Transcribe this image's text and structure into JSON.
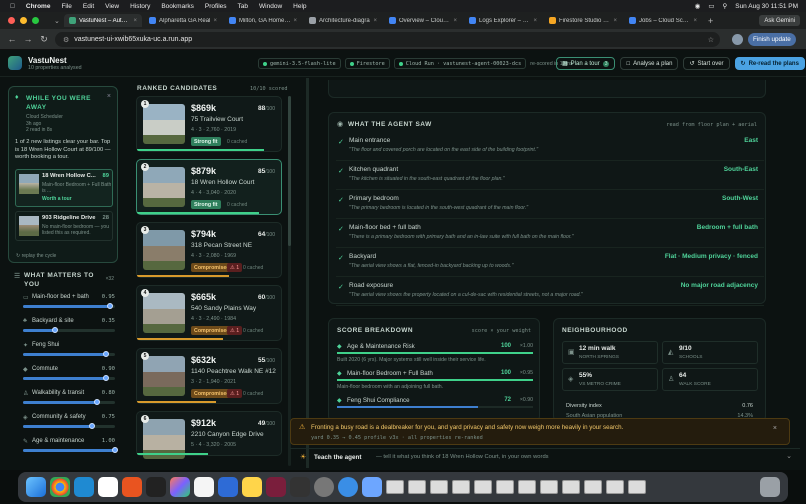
{
  "mac_menu": {
    "app": "Chrome",
    "items": [
      "File",
      "Edit",
      "View",
      "History",
      "Bookmarks",
      "Profiles",
      "Tab",
      "Window",
      "Help"
    ],
    "clock": "Sun Aug 30  11:51 PM",
    "assistant": "Ask Gemini"
  },
  "tabs": [
    {
      "label": "VastuNest – Autono",
      "active": true,
      "color": "#3fa37a"
    },
    {
      "label": "Alpharetta GA Real",
      "active": false,
      "color": "#4285f4"
    },
    {
      "label": "Milton, GA Homes f",
      "active": false,
      "color": "#4285f4"
    },
    {
      "label": "Architecture-diagra",
      "active": false,
      "color": "#9aa0a6"
    },
    {
      "label": "Overview – Cloud R",
      "active": false,
      "color": "#4285f4"
    },
    {
      "label": "Logs Explorer – Log",
      "active": false,
      "color": "#4285f4"
    },
    {
      "label": "Firestore Studio – F",
      "active": false,
      "color": "#f5a623"
    },
    {
      "label": "Jobs – Cloud Schedu",
      "active": false,
      "color": "#4285f4"
    }
  ],
  "address": {
    "url": "vastunest-ui-xwib65xuka-uc.a.run.app",
    "update": "Finish update"
  },
  "app": {
    "name": "VastuNest",
    "subtitle": "10 properties analysed",
    "chips": [
      "gemini-3.5-flash-lite",
      "Firestore",
      "Cloud Run · vastunest-agent-00023-dcs"
    ],
    "rescored": "re-scored in 13ms",
    "plan_tour": "Plan a tour",
    "plan_tour_count": "3",
    "analyse": "Analyse a plan",
    "start_over": "Start over",
    "reread": "Re-read the plans"
  },
  "away": {
    "title": "WHILE YOU WERE AWAY",
    "meta1": "Cloud Scheduler",
    "meta2": "3h ago",
    "meta3": "2 read in 8s",
    "body": "1 of 2 new listings clear your bar. Top is 18 Wren Hollow Court at 89/100 — worth booking a tour.",
    "items": [
      {
        "name": "18 Wren Hollow C...",
        "score": "89",
        "desc": "Main-floor Bedroom + Full Bath is ...",
        "action": "Worth a tour"
      },
      {
        "name": "903 Ridgeline Drive",
        "score": "28",
        "desc": "No main-floor bedroom — you listed this as required.",
        "action": ""
      }
    ],
    "replay": "replay the cycle"
  },
  "matters": {
    "title": "WHAT MATTERS TO YOU",
    "count": "×32",
    "sliders": [
      {
        "label": "Main-floor bed + bath",
        "value": 0.95,
        "display": "0.95",
        "icon": "bed-icon"
      },
      {
        "label": "Backyard & site",
        "value": 0.35,
        "display": "0.35",
        "icon": "tree-icon"
      },
      {
        "label": "Feng Shui",
        "value": 0.9,
        "display": "",
        "icon": "compass-icon"
      },
      {
        "label": "Commute",
        "value": 0.9,
        "display": "0.90",
        "icon": "car-icon"
      },
      {
        "label": "Walkability & transit",
        "value": 0.8,
        "display": "0.80",
        "icon": "walk-icon"
      },
      {
        "label": "Community & safety",
        "value": 0.75,
        "display": "0.75",
        "icon": "shield-icon"
      },
      {
        "label": "Age & maintenance",
        "value": 1.0,
        "display": "1.00",
        "icon": "wrench-icon"
      }
    ]
  },
  "ranked": {
    "title": "RANKED CANDIDATES",
    "count": "10/10 scored",
    "cards": [
      {
        "rank": "1",
        "price": "$869k",
        "score": "88",
        "address": "75 Trailview Court",
        "specs": "4 · 3 · 2,760 · 2019",
        "badge": "Strong fit",
        "badge_type": "fit",
        "warn": "",
        "cached": "0 cached",
        "fill": 0.88,
        "sky": "#9ab3c4",
        "house": "#c9cdc6"
      },
      {
        "rank": "2",
        "price": "$879k",
        "score": "85",
        "address": "18 Wren Hollow Court",
        "specs": "4 · 4 · 3,040 · 2020",
        "badge": "Strong fit",
        "badge_type": "fit",
        "warn": "",
        "cached": "0 cached",
        "fill": 0.85,
        "sky": "#8fa8b8",
        "house": "#b9b3a5"
      },
      {
        "rank": "3",
        "price": "$794k",
        "score": "64",
        "address": "318 Pecan Street NE",
        "specs": "4 · 3 · 2,080 · 1969",
        "badge": "Compromised",
        "badge_type": "comp",
        "warn": "⚠ 1",
        "cached": "0 cached",
        "fill": 0.64,
        "sky": "#7f99a8",
        "house": "#8a7d6a"
      },
      {
        "rank": "4",
        "price": "$665k",
        "score": "60",
        "address": "540 Sandy Plains Way",
        "specs": "4 · 3 · 2,490 · 1984",
        "badge": "Compromised",
        "badge_type": "comp",
        "warn": "⚠ 1",
        "cached": "0 cached",
        "fill": 0.6,
        "sky": "#aab9c2",
        "house": "#a49f92"
      },
      {
        "rank": "5",
        "price": "$632k",
        "score": "55",
        "address": "1140 Peachtree Walk NE #12",
        "specs": "3 · 2 · 1,940 · 2021",
        "badge": "Compromised",
        "badge_type": "comp",
        "warn": "⚠ 1",
        "cached": "0 cached",
        "fill": 0.55,
        "sky": "#90a4b3",
        "house": "#7a6a5c"
      },
      {
        "rank": "6",
        "price": "$912k",
        "score": "49",
        "address": "2210 Canyon Edge Drive",
        "specs": "5 · 4 · 3,320 · 2005",
        "badge": "",
        "badge_type": "",
        "warn": "",
        "cached": "",
        "fill": 0.49,
        "sky": "#8ea3b0",
        "house": "#b8b1a2"
      }
    ]
  },
  "agent_saw": {
    "title": "WHAT THE AGENT SAW",
    "source": "read from floor plan + aerial",
    "items": [
      {
        "title": "Main entrance",
        "quote": "\"The floor and covered porch are located on the east side of the building footprint.\"",
        "value": "East"
      },
      {
        "title": "Kitchen quadrant",
        "quote": "\"The kitchen is situated in the south-east quadrant of the floor plan.\"",
        "value": "South-East"
      },
      {
        "title": "Primary bedroom",
        "quote": "\"The primary bedroom is located in the south-west quadrant of the main floor.\"",
        "value": "South-West"
      },
      {
        "title": "Main-floor bed + full bath",
        "quote": "\"There is a primary bedroom with primary bath and an in-law suite with full bath on the main floor.\"",
        "value": "Bedroom + full bath"
      },
      {
        "title": "Backyard",
        "quote": "\"The aerial view shows a flat, fenced-in backyard backing up to woods.\"",
        "value": "Flat · Medium privacy · fenced"
      },
      {
        "title": "Road exposure",
        "quote": "\"The aerial view shows the property located on a cul-de-sac with residential streets, not a major road.\"",
        "value": "No major road adjacency"
      }
    ]
  },
  "breakdown": {
    "title": "SCORE BREAKDOWN",
    "legend": "score × your weight",
    "rows": [
      {
        "label": "Age & Maintenance Risk",
        "score": "100",
        "weight": "×1.00",
        "desc": "Built 2020 (6 yrs). Major systems still well inside their service life.",
        "fill": 1.0
      },
      {
        "label": "Main-floor Bedroom + Full Bath",
        "score": "100",
        "weight": "×0.95",
        "desc": "Main-floor bedroom with an adjoining full bath.",
        "fill": 1.0
      },
      {
        "label": "Feng Shui Compliance",
        "score": "72",
        "weight": "×0.90",
        "desc": "",
        "fill": 0.72
      }
    ]
  },
  "neighbourhood": {
    "title": "NEIGHBOURHOOD",
    "stats": [
      {
        "value": "12 min walk",
        "label": "NORTH SPRINGS",
        "icon": "train-icon"
      },
      {
        "value": "9/10",
        "label": "SCHOOLS",
        "icon": "school-icon"
      },
      {
        "value": "55%",
        "label": "VS METRO CRIME",
        "icon": "shield-icon"
      },
      {
        "value": "64",
        "label": "WALK SCORE",
        "icon": "walk-icon"
      }
    ],
    "diversity_label": "Diversity index",
    "diversity_value": "0.76",
    "extra_label": "South Asian population",
    "extra_value": "14.3%"
  },
  "notice": {
    "text": "Fronting a busy road is a dealbreaker for you, and yard privacy and safety now weigh more heavily in your search.",
    "sub": "yard 0.35 → 0.45   profile v3x · all properties re-ranked"
  },
  "teach": {
    "label": "Teach the agent",
    "placeholder": "— tell it what you think of 18 Wren Hollow Court, in your own words"
  },
  "colors": {
    "accent": "#3fd18a",
    "primary_btn": "#4ba3e3",
    "warn": "#f3b23a"
  }
}
